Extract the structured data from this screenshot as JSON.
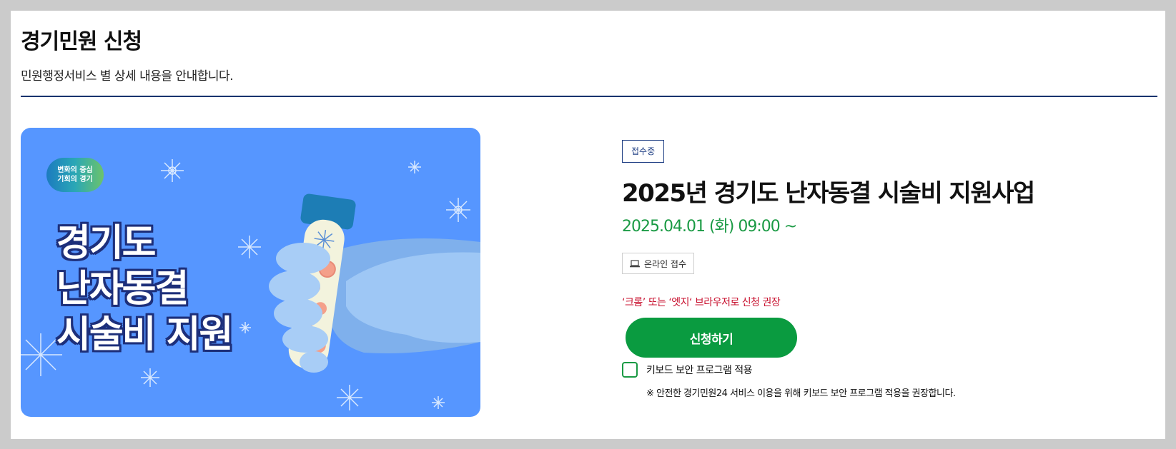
{
  "header": {
    "title": "경기민원 신청",
    "description": "민원행정서비스 별 상세 내용을 안내합니다."
  },
  "banner": {
    "logo_line1": "변화의 중심",
    "logo_line2": "기회의 경기",
    "text_lines": [
      "경기도",
      "난자동결",
      "시술비 지원"
    ]
  },
  "service": {
    "status": "접수중",
    "title": "2025년 경기도 난자동결 시술비 지원사업",
    "date": "2025.04.01 (화) 09:00 ~",
    "channel_icon": "laptop-icon",
    "channel": "온라인 접수",
    "browser_notice": "‘크롬’ 또는 ‘엣지‘ 브라우저로 신청 권장",
    "apply_label": "신청하기",
    "keyboard_security_label": "키보드 보안 프로그램 적용",
    "keyboard_security_checked": false,
    "keyboard_security_notice": "※ 안전한 경기민원24 서비스 이용을 위해 키보드 보안 프로그램 적용을 권장합니다."
  },
  "colors": {
    "accent_green": "#0a9b40",
    "date_green": "#1a9a44",
    "navy": "#12336e",
    "warning_red": "#c8102e",
    "banner_blue": "#5696ff"
  }
}
